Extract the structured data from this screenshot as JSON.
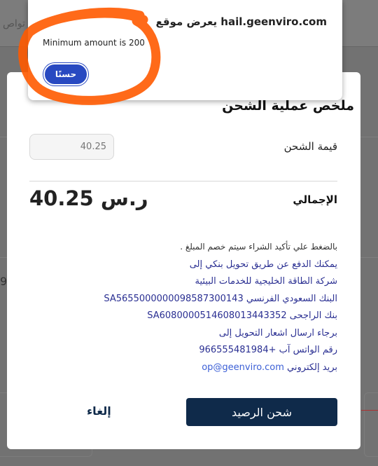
{
  "background": {
    "nav_text": "تواص",
    "side_digit": "9"
  },
  "modal": {
    "title": "ملخص عملية الشحن",
    "amount_label": "قيمة الشحن",
    "amount_value": "40.25",
    "total_label": "الإجمالي",
    "total_value": "40.25 ر.س",
    "info": {
      "note": "بالضغط علي تأكيد الشراء سيتم خصم المبلغ .",
      "lines": [
        "يمكنك الدفع عن طريق تحويل بنكي إلى",
        "شركة الطاقة الخليجية للخدمات البيئية",
        "البنك السعودي الفرنسي SA5655000000098587300143",
        "بنك الراجحى SA6080000514608013443352",
        "برجاء ارسال اشعار التحويل إلى",
        "رقم الواتس آب +966555481984"
      ],
      "email_label": "بريد إلكتروني",
      "email": "op@geenviro.com"
    },
    "charge_button": "شحن الرصيد",
    "cancel_button": "إلغاء"
  },
  "alert": {
    "title": "يعرض موقع hail.geenviro.com",
    "message": "Minimum amount is 200",
    "ok_button": "حسنًا"
  },
  "colors": {
    "primary_dark": "#0f2a4a",
    "alert_button": "#2849c1",
    "link_blue": "#2a2f92",
    "annotation_orange": "#ff5a00"
  }
}
